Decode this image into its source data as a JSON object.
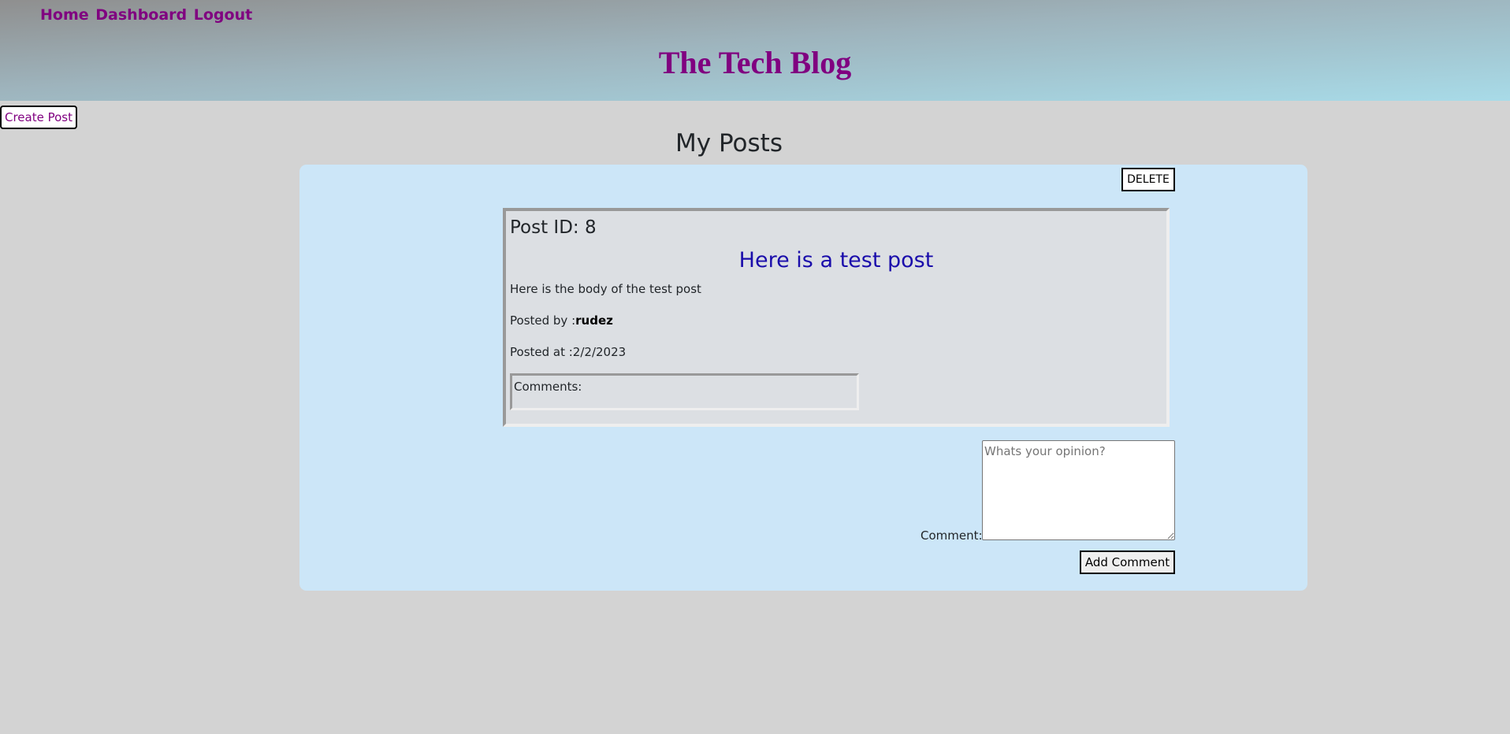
{
  "nav": {
    "home": "Home",
    "dashboard": "Dashboard",
    "logout": "Logout"
  },
  "site_title": "The Tech Blog",
  "create_post_label": "Create Post",
  "page_title": "My Posts",
  "post": {
    "delete_label": "DELETE",
    "id_text": "Post ID: 8",
    "title": "Here is a test post",
    "body": "Here is the body of the test post",
    "posted_by_prefix": "Posted by :",
    "author": "rudez",
    "posted_at_text": "Posted at :2/2/2023",
    "comments_label": "Comments:"
  },
  "comment_form": {
    "label": "Comment:",
    "placeholder": "Whats your opinion?",
    "value": "",
    "submit_label": "Add Comment"
  },
  "colors": {
    "brand_purple": "#800080",
    "post_title_blue": "#1a0dab",
    "panel_bg": "#cce6f8",
    "page_bg": "#d3d3d3"
  }
}
